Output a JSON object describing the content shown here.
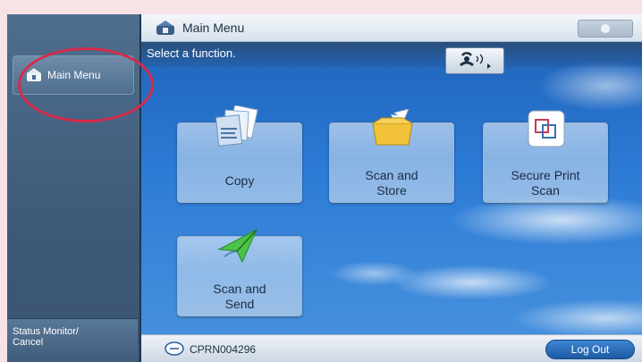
{
  "sidebar": {
    "main_menu_label": "Main Menu",
    "status_monitor_label_line1": "Status Monitor/",
    "status_monitor_label_line2": "Cancel"
  },
  "header": {
    "title": "Main Menu",
    "instruction": "Select a function."
  },
  "tiles": [
    {
      "label_line1": "Copy",
      "label_line2": "",
      "icon": "copy-icon"
    },
    {
      "label_line1": "Scan and",
      "label_line2": "Store",
      "icon": "scan-store-icon"
    },
    {
      "label_line1": "Secure Print",
      "label_line2": "Scan",
      "icon": "secure-print-icon"
    },
    {
      "label_line1": "Scan and",
      "label_line2": "Send",
      "icon": "scan-send-icon"
    }
  ],
  "status_bar": {
    "user_id": "CPRN004296",
    "logout_label": "Log Out"
  },
  "colors": {
    "accent": "#1d5aa3",
    "highlight": "#d62a4a"
  }
}
